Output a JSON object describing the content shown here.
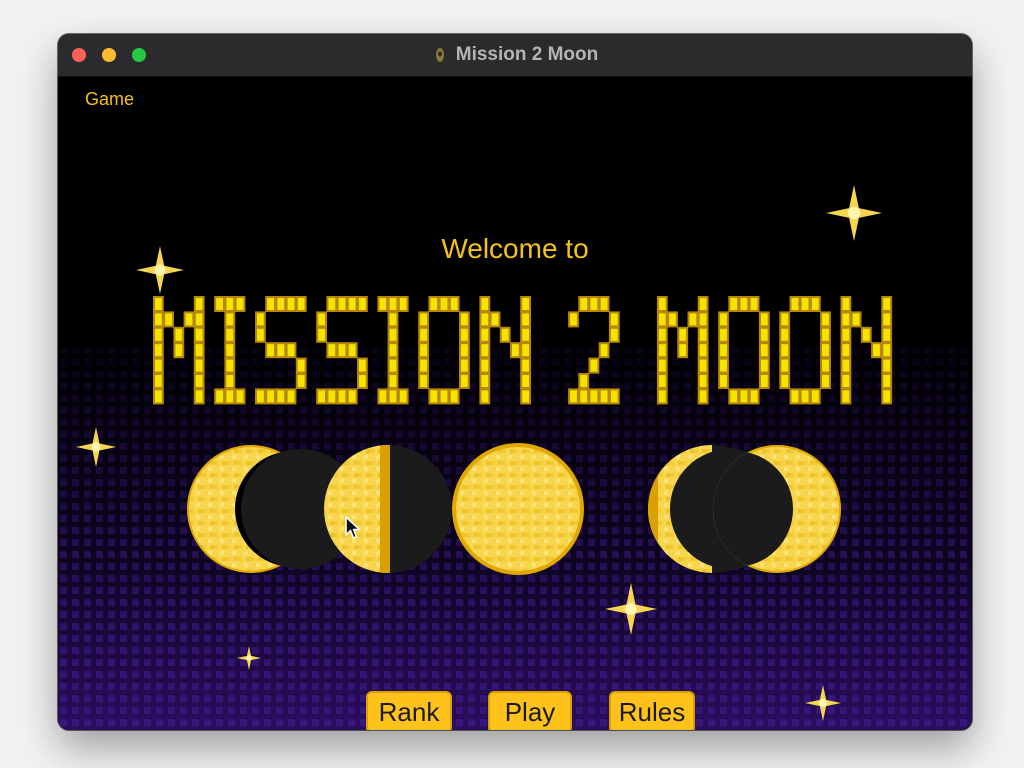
{
  "window": {
    "title": "Mission 2 Moon",
    "title_icon": "rocket-icon"
  },
  "menu": {
    "game_label": "Game"
  },
  "splash": {
    "welcome_text": "Welcome to",
    "game_title": "MISSION 2 MOON",
    "moon_phases": [
      "waning-crescent",
      "new-moon",
      "first-quarter",
      "full-moon",
      "last-quarter",
      "new-moon",
      "waxing-crescent"
    ]
  },
  "buttons": {
    "rank_label": "Rank",
    "play_label": "Play",
    "rules_label": "Rules"
  },
  "colors": {
    "accent_yellow": "#f5c21a",
    "button_yellow": "#ffc21a",
    "moon_yellow": "#f7d34a",
    "moon_dark": "#1b1b1b",
    "background": "#000000",
    "background_bottom": "#2a0e5e"
  }
}
